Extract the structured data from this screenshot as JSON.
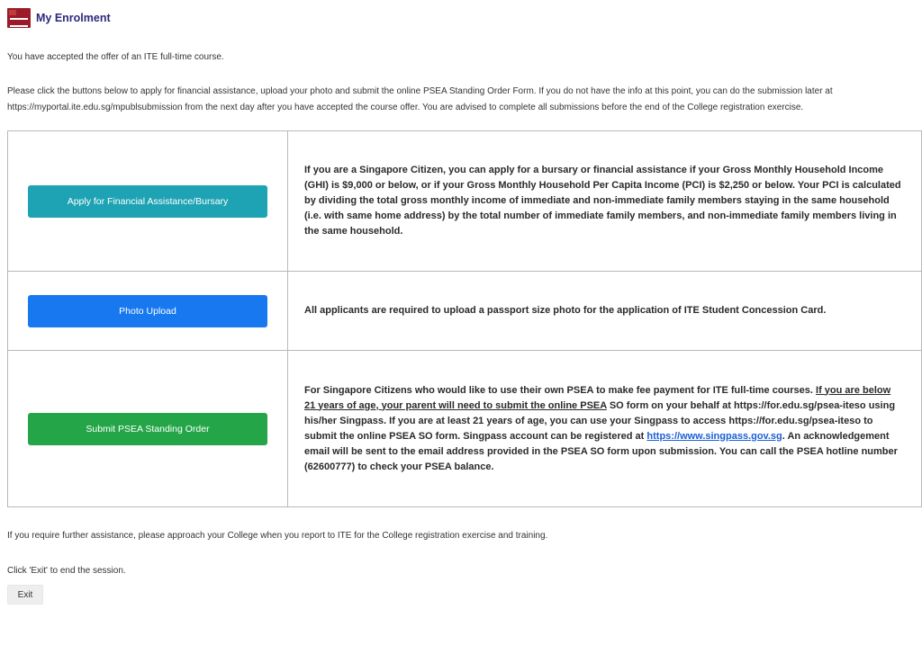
{
  "header": {
    "title": "My Enrolment",
    "logo_icon": "ite-logo"
  },
  "intro": {
    "accepted": "You have accepted the offer of an ITE full-time course.",
    "instructions": "Please click the buttons below to apply for financial assistance, upload your photo and submit the online PSEA Standing Order Form. If you do not have the info at this point, you can do the submission later at https://myportal.ite.edu.sg/mpublsubmission from the next day after you have accepted the course offer. You are advised to complete all submissions before the end of the College registration exercise."
  },
  "rows": [
    {
      "button_label": "Apply for Financial Assistance/Bursary",
      "button_color": "#1ea3b4",
      "text": "If you are a Singapore Citizen, you can apply for a bursary or financial assistance if your Gross Monthly Household Income (GHI) is $9,000 or below, or if your Gross Monthly Household Per Capita Income (PCI) is $2,250 or below. Your PCI is calculated by dividing the total gross monthly income of immediate and non-immediate family members staying in the same household (i.e. with same home address) by the total number of immediate family members, and non-immediate family members living in the same household."
    },
    {
      "button_label": "Photo Upload",
      "button_color": "#1778f0",
      "text": "All applicants are required to upload a passport size photo for the application of ITE Student Concession Card."
    },
    {
      "button_label": "Submit PSEA Standing Order",
      "button_color": "#24a548",
      "text_part1": "For Singapore Citizens who would like to use their own PSEA to make fee payment for ITE full-time courses. ",
      "text_underlined": "If you are below 21 years of age, your parent will need to submit the online PSEA",
      "text_part2": " SO form on your behalf at https://for.edu.sg/psea-iteso using his/her Singpass. If you are at least 21 years of age, you can use your Singpass to access https://for.edu.sg/psea-iteso to submit the online PSEA SO form. Singpass account can be registered at ",
      "text_link": "https://www.singpass.gov.sg",
      "text_part3": ". An acknowledgement email will be sent to the email address provided in the PSEA SO form upon submission. You can call the PSEA hotline number (62600777) to check your PSEA balance."
    }
  ],
  "footer": {
    "further_assistance": "If you require further assistance, please approach your College when you report to ITE for the College registration exercise and training.",
    "click_exit": "Click 'Exit' to end the session.",
    "exit_label": "Exit"
  }
}
